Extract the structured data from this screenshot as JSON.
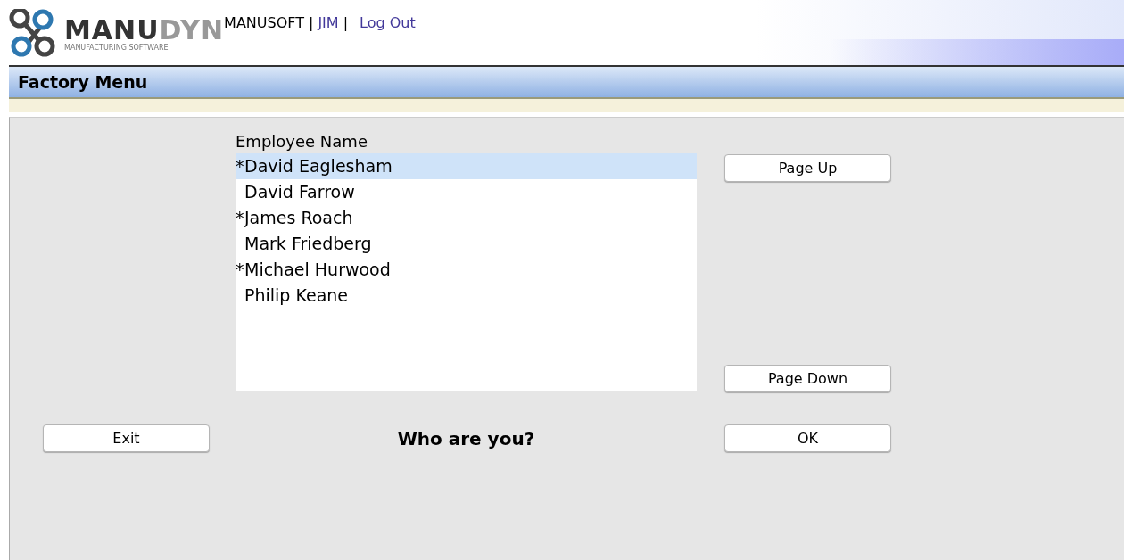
{
  "header": {
    "logo": {
      "text_dark": "MANU",
      "text_light": "DYN",
      "tagline": "MANUFACTURING SOFTWARE"
    },
    "company": "MANUSOFT",
    "separator_1": "|",
    "user_link": "JIM",
    "separator_2": "|",
    "logout_link": "Log Out"
  },
  "title_bar": {
    "title": "Factory Menu"
  },
  "employee_list": {
    "heading": "Employee Name",
    "items": [
      {
        "marker": "*",
        "name": "David Eaglesham",
        "selected": true
      },
      {
        "name": "David Farrow",
        "selected": false
      },
      {
        "marker": "*",
        "name": "James Roach",
        "selected": false
      },
      {
        "name": "Mark Friedberg",
        "selected": false
      },
      {
        "marker": "*",
        "name": "Michael Hurwood",
        "selected": false
      },
      {
        "name": "Philip Keane",
        "selected": false
      }
    ]
  },
  "buttons": {
    "page_up": "Page Up",
    "page_down": "Page Down",
    "exit": "Exit",
    "ok": "OK"
  },
  "prompt": "Who are you?"
}
